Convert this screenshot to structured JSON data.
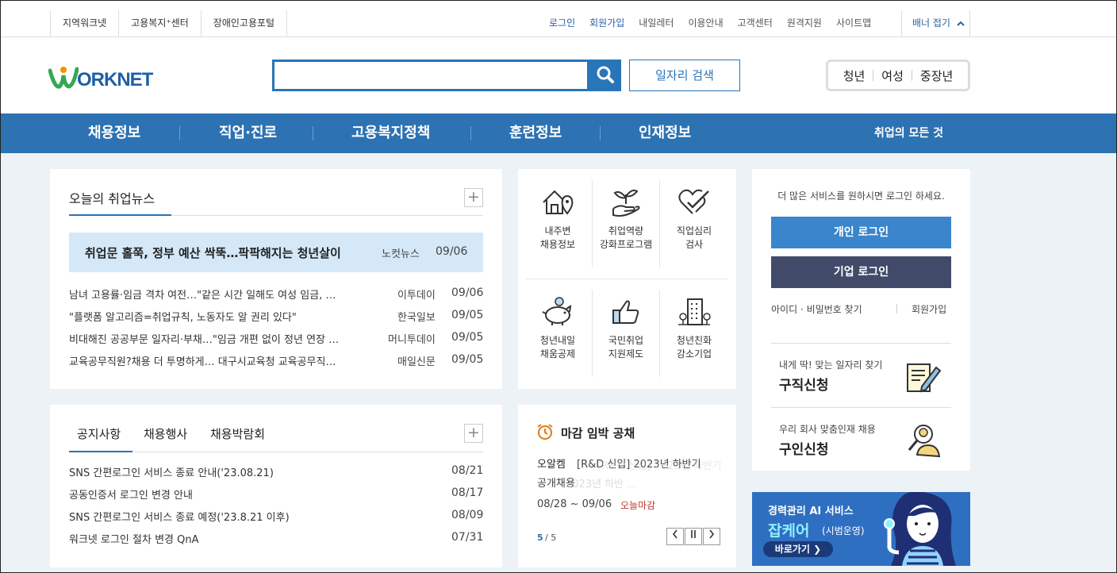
{
  "topbar": {
    "left_links": [
      "지역워크넷",
      "고용복지⁺센터",
      "장애인고용포털"
    ],
    "right_links": [
      "로그인",
      "회원가입",
      "내일레터",
      "이용안내",
      "고객센터",
      "원격지원",
      "사이트맵"
    ],
    "banner_fold": "배너 접기"
  },
  "header": {
    "logo_text": "ORKNET",
    "search_placeholder": "",
    "job_search_label": "일자리 검색",
    "targets": [
      "청년",
      "여성",
      "중장년"
    ]
  },
  "nav": {
    "items": [
      "채용정보",
      "직업·진로",
      "고용복지정책",
      "훈련정보",
      "인재정보"
    ],
    "all_label": "취업의 모든 것"
  },
  "news": {
    "title": "오늘의 취업뉴스",
    "headline": {
      "title": "취업문 홀쭉, 정부 예산 싹뚝…팍팍해지는 청년살이",
      "source": "노컷뉴스",
      "date": "09/06"
    },
    "rows": [
      {
        "title": "남녀 고용률·임금 격차 여전…\"같은 시간 일해도 여성 임금, …",
        "source": "이투데이",
        "date": "09/06"
      },
      {
        "title": "\"플랫폼 알고리즘=취업규칙, 노동자도 알 권리 있다\"",
        "source": "한국일보",
        "date": "09/05"
      },
      {
        "title": "비대해진 공공부문 일자리·부채…\"임금 개편 없이 정년 연장 …",
        "source": "머니투데이",
        "date": "09/05"
      },
      {
        "title": "교육공무직원?채용 더 투명하게… 대구시교육청 교육공무직…",
        "source": "매일신문",
        "date": "09/05"
      }
    ]
  },
  "services": [
    {
      "line1": "내주변",
      "line2": "채용정보",
      "icon": "house-pin-icon"
    },
    {
      "line1": "취업역량",
      "line2": "강화프로그램",
      "icon": "sprout-hand-icon"
    },
    {
      "line1": "직업심리",
      "line2": "검사",
      "icon": "heart-check-icon"
    },
    {
      "line1": "청년내일",
      "line2": "채움공제",
      "icon": "piggy-bank-icon"
    },
    {
      "line1": "국민취업",
      "line2": "지원제도",
      "icon": "thumbs-up-icon"
    },
    {
      "line1": "청년친화",
      "line2": "강소기업",
      "icon": "building-icon"
    }
  ],
  "login": {
    "message": "더 많은 서비스를 원하시면 로그인 하세요.",
    "personal": "개인 로그인",
    "company": "기업 로그인",
    "find": "아이디 · 비밀번호 찾기",
    "join": "회원가입",
    "job_apply_small": "내게 딱! 맞는 일자리 찾기",
    "job_apply_big": "구직신청",
    "hire_small": "우리 회사 맞춤인재 채용",
    "hire_big": "구인신청"
  },
  "notice": {
    "tabs": [
      "공지사항",
      "채용행사",
      "채용박람회"
    ],
    "items": [
      {
        "title": "SNS 간편로그인 서비스 종료 안내('23.08.21)",
        "date": "08/21"
      },
      {
        "title": "공동인증서 로그인 변경 안내",
        "date": "08/17"
      },
      {
        "title": "SNS 간편로그인 서비스 종료 예정('23.8.21 이후)",
        "date": "08/09"
      },
      {
        "title": "워크넷 로그인 절차 변경 QnA",
        "date": "07/31"
      }
    ]
  },
  "deadline": {
    "title": "마감 임박 공채",
    "company": "오알켐",
    "job_line1": "[R&D 신입] 2023년 하반기",
    "job_line2": "공개채용",
    "ghost_line1": "[R&D 신입] 2023년 하반기",
    "ghost_line2": "2023년 하반 …",
    "period": "08/28 ~ 09/06",
    "status": "오늘마감",
    "page_current": "5",
    "page_total": "/ 5"
  },
  "banner": {
    "line1": "경력관리 AI 서비스",
    "line2": "잡케어",
    "line2_sub": "(시범운영)",
    "cta": "바로가기 ❯"
  },
  "colors": {
    "brand_blue": "#2d72b2",
    "dark_navy": "#414b69",
    "deadline_red": "#c0392b"
  }
}
